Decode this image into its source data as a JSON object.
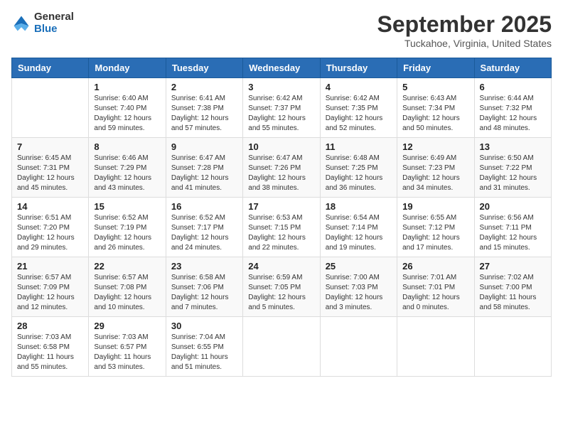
{
  "logo": {
    "general": "General",
    "blue": "Blue"
  },
  "title": "September 2025",
  "subtitle": "Tuckahoe, Virginia, United States",
  "days_of_week": [
    "Sunday",
    "Monday",
    "Tuesday",
    "Wednesday",
    "Thursday",
    "Friday",
    "Saturday"
  ],
  "weeks": [
    [
      {
        "day": "",
        "info": ""
      },
      {
        "day": "1",
        "info": "Sunrise: 6:40 AM\nSunset: 7:40 PM\nDaylight: 12 hours\nand 59 minutes."
      },
      {
        "day": "2",
        "info": "Sunrise: 6:41 AM\nSunset: 7:38 PM\nDaylight: 12 hours\nand 57 minutes."
      },
      {
        "day": "3",
        "info": "Sunrise: 6:42 AM\nSunset: 7:37 PM\nDaylight: 12 hours\nand 55 minutes."
      },
      {
        "day": "4",
        "info": "Sunrise: 6:42 AM\nSunset: 7:35 PM\nDaylight: 12 hours\nand 52 minutes."
      },
      {
        "day": "5",
        "info": "Sunrise: 6:43 AM\nSunset: 7:34 PM\nDaylight: 12 hours\nand 50 minutes."
      },
      {
        "day": "6",
        "info": "Sunrise: 6:44 AM\nSunset: 7:32 PM\nDaylight: 12 hours\nand 48 minutes."
      }
    ],
    [
      {
        "day": "7",
        "info": "Sunrise: 6:45 AM\nSunset: 7:31 PM\nDaylight: 12 hours\nand 45 minutes."
      },
      {
        "day": "8",
        "info": "Sunrise: 6:46 AM\nSunset: 7:29 PM\nDaylight: 12 hours\nand 43 minutes."
      },
      {
        "day": "9",
        "info": "Sunrise: 6:47 AM\nSunset: 7:28 PM\nDaylight: 12 hours\nand 41 minutes."
      },
      {
        "day": "10",
        "info": "Sunrise: 6:47 AM\nSunset: 7:26 PM\nDaylight: 12 hours\nand 38 minutes."
      },
      {
        "day": "11",
        "info": "Sunrise: 6:48 AM\nSunset: 7:25 PM\nDaylight: 12 hours\nand 36 minutes."
      },
      {
        "day": "12",
        "info": "Sunrise: 6:49 AM\nSunset: 7:23 PM\nDaylight: 12 hours\nand 34 minutes."
      },
      {
        "day": "13",
        "info": "Sunrise: 6:50 AM\nSunset: 7:22 PM\nDaylight: 12 hours\nand 31 minutes."
      }
    ],
    [
      {
        "day": "14",
        "info": "Sunrise: 6:51 AM\nSunset: 7:20 PM\nDaylight: 12 hours\nand 29 minutes."
      },
      {
        "day": "15",
        "info": "Sunrise: 6:52 AM\nSunset: 7:19 PM\nDaylight: 12 hours\nand 26 minutes."
      },
      {
        "day": "16",
        "info": "Sunrise: 6:52 AM\nSunset: 7:17 PM\nDaylight: 12 hours\nand 24 minutes."
      },
      {
        "day": "17",
        "info": "Sunrise: 6:53 AM\nSunset: 7:15 PM\nDaylight: 12 hours\nand 22 minutes."
      },
      {
        "day": "18",
        "info": "Sunrise: 6:54 AM\nSunset: 7:14 PM\nDaylight: 12 hours\nand 19 minutes."
      },
      {
        "day": "19",
        "info": "Sunrise: 6:55 AM\nSunset: 7:12 PM\nDaylight: 12 hours\nand 17 minutes."
      },
      {
        "day": "20",
        "info": "Sunrise: 6:56 AM\nSunset: 7:11 PM\nDaylight: 12 hours\nand 15 minutes."
      }
    ],
    [
      {
        "day": "21",
        "info": "Sunrise: 6:57 AM\nSunset: 7:09 PM\nDaylight: 12 hours\nand 12 minutes."
      },
      {
        "day": "22",
        "info": "Sunrise: 6:57 AM\nSunset: 7:08 PM\nDaylight: 12 hours\nand 10 minutes."
      },
      {
        "day": "23",
        "info": "Sunrise: 6:58 AM\nSunset: 7:06 PM\nDaylight: 12 hours\nand 7 minutes."
      },
      {
        "day": "24",
        "info": "Sunrise: 6:59 AM\nSunset: 7:05 PM\nDaylight: 12 hours\nand 5 minutes."
      },
      {
        "day": "25",
        "info": "Sunrise: 7:00 AM\nSunset: 7:03 PM\nDaylight: 12 hours\nand 3 minutes."
      },
      {
        "day": "26",
        "info": "Sunrise: 7:01 AM\nSunset: 7:01 PM\nDaylight: 12 hours\nand 0 minutes."
      },
      {
        "day": "27",
        "info": "Sunrise: 7:02 AM\nSunset: 7:00 PM\nDaylight: 11 hours\nand 58 minutes."
      }
    ],
    [
      {
        "day": "28",
        "info": "Sunrise: 7:03 AM\nSunset: 6:58 PM\nDaylight: 11 hours\nand 55 minutes."
      },
      {
        "day": "29",
        "info": "Sunrise: 7:03 AM\nSunset: 6:57 PM\nDaylight: 11 hours\nand 53 minutes."
      },
      {
        "day": "30",
        "info": "Sunrise: 7:04 AM\nSunset: 6:55 PM\nDaylight: 11 hours\nand 51 minutes."
      },
      {
        "day": "",
        "info": ""
      },
      {
        "day": "",
        "info": ""
      },
      {
        "day": "",
        "info": ""
      },
      {
        "day": "",
        "info": ""
      }
    ]
  ]
}
